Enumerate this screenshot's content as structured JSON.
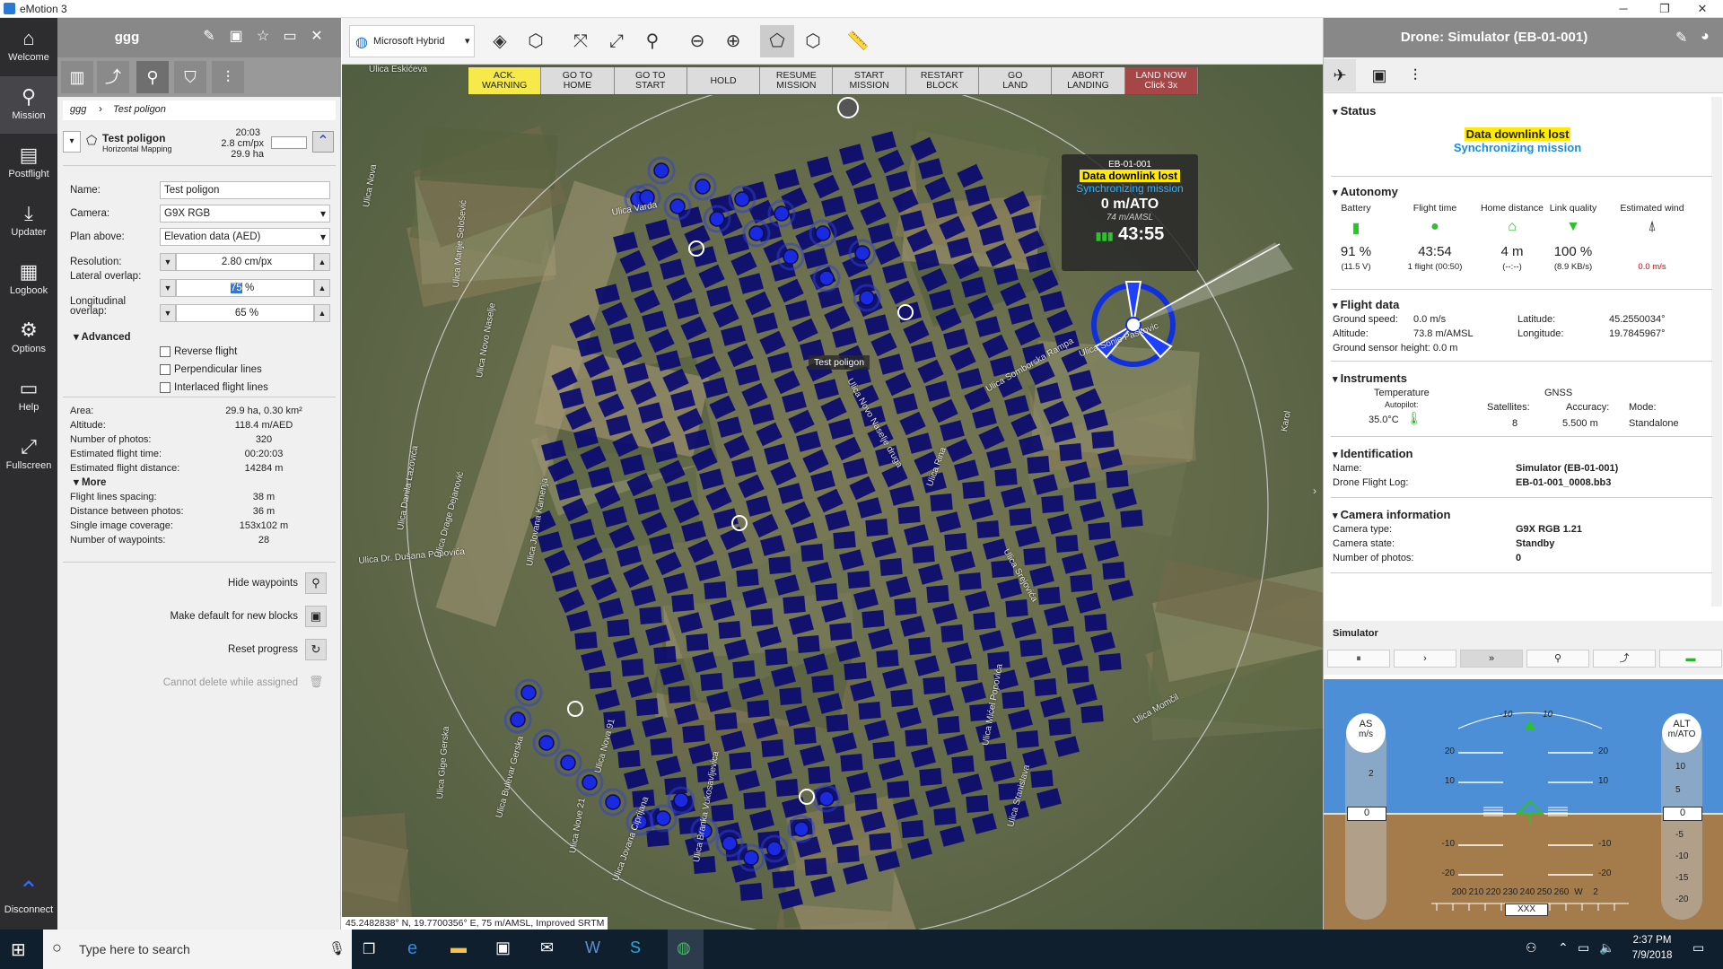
{
  "window": {
    "title": "eMotion 3"
  },
  "nav": [
    {
      "label": "Welcome",
      "icon": "home-icon",
      "glyph": "⌂"
    },
    {
      "label": "Mission",
      "icon": "mission-icon",
      "glyph": "⚲"
    },
    {
      "label": "Postflight",
      "icon": "postflight-icon",
      "glyph": "▤"
    },
    {
      "label": "Updater",
      "icon": "download-icon",
      "glyph": "⤓"
    },
    {
      "label": "Logbook",
      "icon": "logbook-icon",
      "glyph": "▦"
    },
    {
      "label": "Options",
      "icon": "gear-icon",
      "glyph": "⚙"
    },
    {
      "label": "Help",
      "icon": "book-icon",
      "glyph": "▭"
    },
    {
      "label": "Fullscreen",
      "icon": "fullscreen-icon",
      "glyph": "⤢"
    },
    {
      "label": "Disconnect",
      "icon": "drone-icon",
      "glyph": "⌃"
    }
  ],
  "left": {
    "title": "ggg",
    "breadcrumb": [
      "ggg",
      "Test poligon"
    ],
    "block": {
      "name": "Test poligon",
      "type": "Horizontal Mapping",
      "time": "20:03",
      "res": "2.8 cm/px",
      "area": "29.9 ha"
    },
    "form": {
      "name_label": "Name:",
      "name_value": "Test poligon",
      "camera_label": "Camera:",
      "camera_value": "G9X RGB",
      "plan_label": "Plan above:",
      "plan_value": "Elevation data (AED)",
      "res_label": "Resolution:",
      "res_value": "2.80 cm/px",
      "lat_label": "Lateral overlap:",
      "lat_value": "75",
      "lon_label": "Longitudinal overlap:",
      "lon_value": "65 %",
      "pct": "%"
    },
    "advanced": {
      "label": "Advanced",
      "options": [
        "Reverse flight",
        "Perpendicular lines",
        "Interlaced flight lines"
      ]
    },
    "stats": [
      {
        "k": "Area:",
        "v": "29.9 ha, 0.30 km²"
      },
      {
        "k": "Altitude:",
        "v": "118.4 m/AED"
      },
      {
        "k": "Number of photos:",
        "v": "320"
      },
      {
        "k": "Estimated flight time:",
        "v": "00:20:03"
      },
      {
        "k": "Estimated flight distance:",
        "v": "14284 m"
      }
    ],
    "more": {
      "label": "More"
    },
    "more_stats": [
      {
        "k": "Flight lines spacing:",
        "v": "38 m"
      },
      {
        "k": "Distance between photos:",
        "v": "36 m"
      },
      {
        "k": "Single image coverage:",
        "v": "153x102 m"
      },
      {
        "k": "Number of waypoints:",
        "v": "28"
      }
    ],
    "actions": {
      "hide": "Hide waypoints",
      "default": "Make default for new blocks",
      "reset": "Reset progress",
      "delete": "Cannot delete while assigned"
    }
  },
  "map": {
    "layer": "Microsoft Hybrid",
    "commands": [
      {
        "l1": "ACK.",
        "l2": "WARNING"
      },
      {
        "l1": "GO TO",
        "l2": "HOME"
      },
      {
        "l1": "GO TO",
        "l2": "START"
      },
      {
        "l1": "HOLD",
        "l2": ""
      },
      {
        "l1": "RESUME",
        "l2": "MISSION"
      },
      {
        "l1": "START",
        "l2": "MISSION"
      },
      {
        "l1": "RESTART",
        "l2": "BLOCK"
      },
      {
        "l1": "GO",
        "l2": "LAND"
      },
      {
        "l1": "ABORT",
        "l2": "LANDING"
      },
      {
        "l1": "LAND NOW",
        "l2": "Click 3x"
      }
    ],
    "drone_label": {
      "id": "EB-01-001",
      "warn": "Data downlink lost",
      "sync": "Synchronizing mission",
      "alt": "0 m/ATO",
      "amsl": "74 m/AMSL",
      "time": "43:55"
    },
    "polygon_label": "Test poligon",
    "streets": [
      "Ulica Eskićeva",
      "Ulica Varda",
      "Ulica Nova",
      "Ulica Marije Selošević",
      "Ulica Novo Naselje",
      "Ulica Novo Naselje druga",
      "Ulica Somborska Rampa",
      "Ulica Sonje Paskovic",
      "Ulica Rina",
      "Ulica Srejovića",
      "Ulica Dr. Dušana Popovića",
      "Ulica Danila Lazovića",
      "Ulica Drage Dejanović",
      "Ulica Jovana Kamenja",
      "Ulica Nova 91",
      "Ulica Gige Gerska",
      "Ulica Bulevar Gerska",
      "Ulica Nove 21",
      "Ulica Jovana Ciprijana",
      "Ulica Branka Vukosavljevica",
      "Ulica Mićel Popovića",
      "Ulica Momčil",
      "Ulica Stanislava",
      "Karol"
    ],
    "status": "45.2482838° N, 19.7700356° E, 75 m/AMSL, Improved SRTM"
  },
  "right": {
    "title": "Drone: Simulator (EB-01-001)",
    "status": {
      "label": "Status",
      "warn": "Data downlink lost",
      "sync": "Synchronizing mission"
    },
    "autonomy": {
      "label": "Autonomy",
      "cols": [
        {
          "h": "Battery",
          "v": "91 %",
          "s": "(11.5 V)",
          "icon": "battery-icon"
        },
        {
          "h": "Flight time",
          "v": "43:54",
          "s": "1 flight (00:50)",
          "icon": "clock-icon"
        },
        {
          "h": "Home distance",
          "v": "4 m",
          "s": "(--:--)",
          "icon": "home-icon"
        },
        {
          "h": "Link quality",
          "v": "100 %",
          "s": "(8.9 KB/s)",
          "icon": "wifi-icon"
        },
        {
          "h": "Estimated wind",
          "v": "",
          "s": "0.0 m/s",
          "icon": "wind-arrow-icon"
        }
      ]
    },
    "flight": {
      "label": "Flight data",
      "gs_k": "Ground speed:",
      "gs_v": "0.0 m/s",
      "alt_k": "Altitude:",
      "alt_v": "73.8 m/AMSL",
      "lat_k": "Latitude:",
      "lat_v": "45.2550034°",
      "lon_k": "Longitude:",
      "lon_v": "19.7845967°",
      "gsh": "Ground sensor height: 0.0 m"
    },
    "instruments": {
      "label": "Instruments",
      "temp": "Temperature",
      "autopilot": "Autopilot:",
      "temp_v": "35.0°C",
      "gnss": "GNSS",
      "sat_k": "Satellites:",
      "sat_v": "8",
      "acc_k": "Accuracy:",
      "acc_v": "5.500 m",
      "mode_k": "Mode:",
      "mode_v": "Standalone"
    },
    "ident": {
      "label": "Identification",
      "name_k": "Name:",
      "name_v": "Simulator (EB-01-001)",
      "log_k": "Drone Flight Log:",
      "log_v": "EB-01-001_0008.bb3"
    },
    "camera": {
      "label": "Camera information",
      "type_k": "Camera type:",
      "type_v": "G9X RGB 1.21",
      "state_k": "Camera state:",
      "state_v": "Standby",
      "num_k": "Number of photos:",
      "num_v": "0"
    },
    "sim": {
      "label": "Simulator"
    },
    "pfd": {
      "as": "AS",
      "as_u": "m/s",
      "alt": "ALT",
      "alt_u": "m/ATO",
      "as_val": "0",
      "alt_val": "0",
      "as_tick": "2",
      "alt_ticks": [
        "10",
        "5",
        "-5",
        "-10",
        "-15",
        "-20"
      ],
      "pitch": [
        "20",
        "10",
        "-10",
        "-20"
      ],
      "roll": [
        "-10",
        "10"
      ],
      "hdg": [
        "200",
        "210",
        "220",
        "230",
        "240",
        "250",
        "260",
        "W",
        "2"
      ],
      "hdg_box": "XXX"
    }
  },
  "taskbar": {
    "search": "Type here to search",
    "time": "2:37 PM",
    "date": "7/9/2018"
  }
}
